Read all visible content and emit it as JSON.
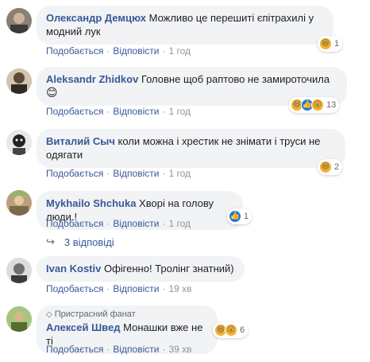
{
  "comments": [
    {
      "author": "Олександр Демцюх",
      "text": "Можливо це перешиті єпітрахилі у модний лук",
      "reaction_count": "1",
      "time": "1 год"
    },
    {
      "author": "Aleksandr Zhidkov",
      "text": "Головне щоб раптово не замироточила",
      "emoji_in_text": "😊",
      "reaction_count": "13",
      "time": "1 год"
    },
    {
      "author": "Виталий Сыч",
      "text": "коли можна і хрестик не знімати і труси не одягати",
      "reaction_count": "2",
      "time": "1 год"
    },
    {
      "author": "Mykhailo Shchuka",
      "text": "Хворі на голову люди.!",
      "reaction_count": "1",
      "time": "1 год"
    },
    {
      "author": "Ivan Kostiv",
      "text": "Офігенно! Тролінг знатний)",
      "time": "19 хв"
    },
    {
      "badge": "Пристрасний фанат",
      "author": "Алексей Швед",
      "text": "Монашки вже не ті",
      "reaction_count": "6",
      "time": "39 хв"
    }
  ],
  "actions": {
    "like": "Подобається",
    "reply": "Відповісти",
    "sep": "·"
  },
  "replies_toggle": {
    "icon": "reply-arrow-icon",
    "label": "3 відповіді"
  },
  "colors": {
    "author": "#385898",
    "bubble": "#f2f3f5",
    "meta": "#606770",
    "like": "#1877f2",
    "haha": "#f7b125"
  }
}
